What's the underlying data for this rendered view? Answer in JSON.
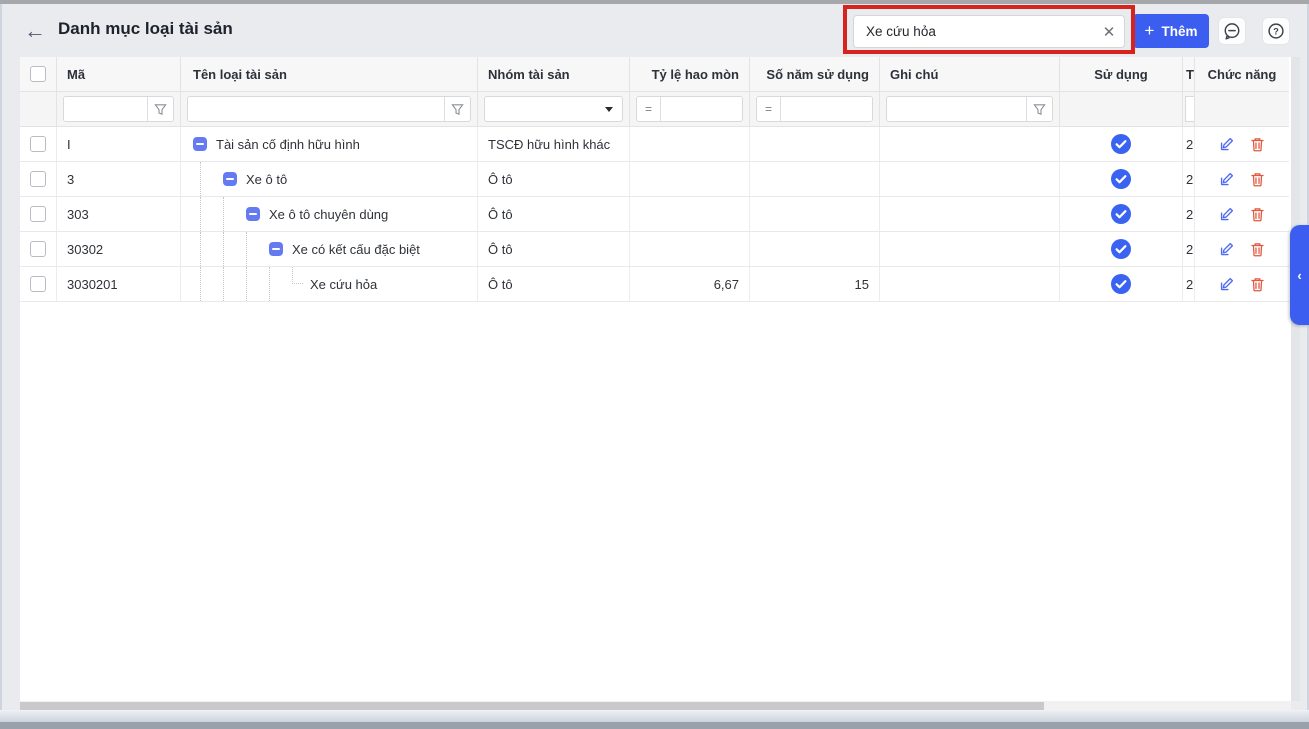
{
  "page": {
    "title": "Danh mục loại tài sản"
  },
  "toolbar": {
    "search_value": "Xe cứu hỏa",
    "clear_glyph": "✕",
    "add_plus": "+",
    "add_label": "Thêm"
  },
  "table": {
    "headers": {
      "ma": "Mã",
      "ten": "Tên loại tài sản",
      "nhom": "Nhóm tài sản",
      "ty_le": "Tỷ lệ hao mòn",
      "so_nam": "Số năm sử dụng",
      "ghi_chu": "Ghi chú",
      "su_dung": "Sử dụng",
      "clipped": "T",
      "chuc_nang": "Chức năng"
    },
    "filter": {
      "equals": "="
    },
    "rows": [
      {
        "code": "I",
        "name": "Tài sản cố định hữu hình",
        "group": "TSCĐ hữu hình khác",
        "rate": "",
        "years": "",
        "note": "",
        "in_use": true,
        "clipped": "2"
      },
      {
        "code": "3",
        "name": "Xe ô tô",
        "group": "Ô tô",
        "rate": "",
        "years": "",
        "note": "",
        "in_use": true,
        "clipped": "2"
      },
      {
        "code": "303",
        "name": "Xe ô tô chuyên dùng",
        "group": "Ô tô",
        "rate": "",
        "years": "",
        "note": "",
        "in_use": true,
        "clipped": "2"
      },
      {
        "code": "30302",
        "name": "Xe có kết cấu đặc biệt",
        "group": "Ô tô",
        "rate": "",
        "years": "",
        "note": "",
        "in_use": true,
        "clipped": "2"
      },
      {
        "code": "3030201",
        "name": "Xe cứu hỏa",
        "group": "Ô tô",
        "rate": "6,67",
        "years": "15",
        "note": "",
        "in_use": true,
        "clipped": "2"
      }
    ]
  },
  "icons": {
    "back": "←",
    "collapse": "minus-square",
    "in_use": "check-circle",
    "edit": "pencil",
    "delete": "trash",
    "chat": "comment-bubble",
    "help": "question-circle",
    "filter": "funnel",
    "panel_toggle": "‹"
  },
  "colors": {
    "accent": "#3b5ef0",
    "annotation": "#d7231d",
    "tree_icon": "#6479f2",
    "check": "#3a63f1",
    "edit": "#4f6bf0",
    "delete": "#e2573d"
  }
}
